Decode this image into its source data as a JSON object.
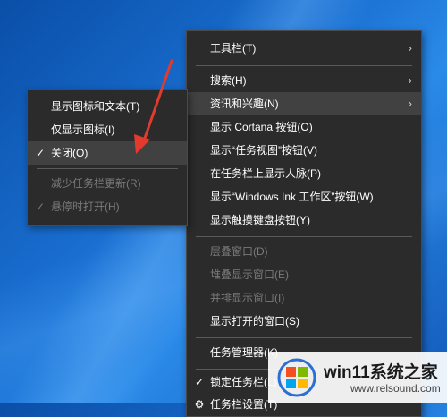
{
  "main_menu": {
    "items": [
      {
        "label": "工具栏(T)",
        "submenu": true
      },
      {
        "label": "搜索(H)",
        "submenu": true
      },
      {
        "label": "资讯和兴趣(N)",
        "submenu": true
      },
      {
        "label": "显示 Cortana 按钮(O)"
      },
      {
        "label": "显示“任务视图”按钮(V)"
      },
      {
        "label": "在任务栏上显示人脉(P)"
      },
      {
        "label": "显示“Windows Ink 工作区”按钮(W)"
      },
      {
        "label": "显示触摸键盘按钮(Y)"
      },
      {
        "label": "层叠窗口(D)",
        "disabled": true
      },
      {
        "label": "堆叠显示窗口(E)",
        "disabled": true
      },
      {
        "label": "并排显示窗口(I)",
        "disabled": true
      },
      {
        "label": "显示打开的窗口(S)"
      },
      {
        "label": "任务管理器(K)"
      },
      {
        "label": "锁定任务栏(L)",
        "checked": true
      },
      {
        "label": "任务栏设置(T)"
      }
    ]
  },
  "sub_menu": {
    "items": [
      {
        "label": "显示图标和文本(T)"
      },
      {
        "label": "仅显示图标(I)"
      },
      {
        "label": "关闭(O)",
        "checked": true
      },
      {
        "label": "减少任务栏更新(R)",
        "disabled": true
      },
      {
        "label": "悬停时打开(H)",
        "checked": true,
        "disabled": true
      }
    ]
  },
  "icons": {
    "check": "✓",
    "chevron": "›"
  },
  "watermark": {
    "title": "win11系统之家",
    "url": "www.relsound.com"
  },
  "colors": {
    "arrow": "#e23b2e",
    "menu_bg": "#2b2b2b",
    "disabled": "#7a7a7a"
  }
}
